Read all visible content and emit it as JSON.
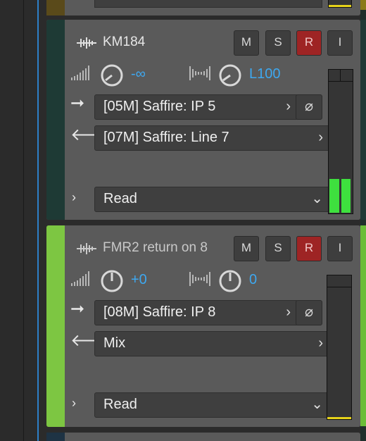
{
  "tracks": [
    {
      "name": "KM184",
      "color": "#1e3a35",
      "buttons": {
        "mute": "M",
        "solo": "S",
        "record": "R",
        "input": "I"
      },
      "volume_value": "-∞",
      "pan_value": "L100",
      "input_routing": "[05M] Saffire:  IP 5",
      "output_routing": "[07M] Saffire:  Line 7",
      "automation_mode": "Read",
      "meter_level": 0.24
    },
    {
      "name": "FMR2 return on 8",
      "color": "#7dc642",
      "buttons": {
        "mute": "M",
        "solo": "S",
        "record": "R",
        "input": "I"
      },
      "volume_value": "+0",
      "pan_value": "0",
      "input_routing": "[08M] Saffire:  IP 8",
      "output_routing": "Mix",
      "automation_mode": "Read",
      "meter_level": 0.0
    }
  ],
  "icons": {
    "input_arrow": "arrow-right-icon",
    "output_arrow": "arrow-left-icon",
    "phase": "phase-invert-icon"
  },
  "colors": {
    "accent_blue": "#3ea8f0",
    "record_red": "#9e2424",
    "meter_green": "#3ee03e",
    "meter_yellow": "#e6d21a"
  }
}
